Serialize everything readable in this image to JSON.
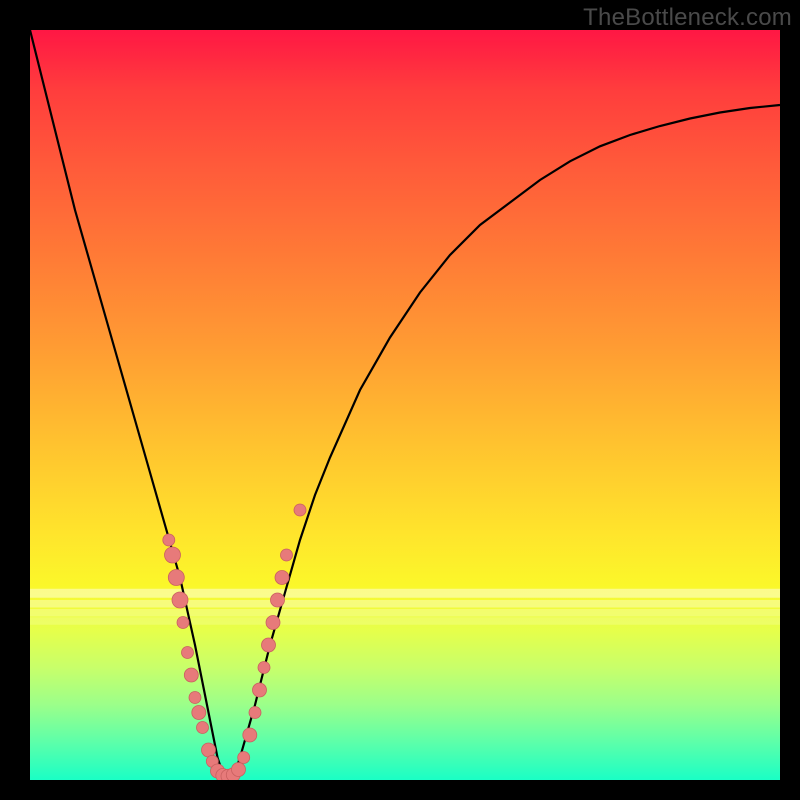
{
  "watermark": "TheBottleneck.com",
  "colors": {
    "curve_stroke": "#000000",
    "dot_fill": "#e77a7a",
    "dot_stroke": "#c96060"
  },
  "chart_data": {
    "type": "line",
    "title": "",
    "xlabel": "",
    "ylabel": "",
    "xlim": [
      0,
      100
    ],
    "ylim": [
      0,
      100
    ],
    "series": [
      {
        "name": "bottleneck-curve",
        "x": [
          0,
          2,
          4,
          6,
          8,
          10,
          12,
          14,
          16,
          18,
          20,
          22,
          23,
          24,
          25,
          26,
          27,
          28,
          30,
          32,
          34,
          36,
          38,
          40,
          44,
          48,
          52,
          56,
          60,
          64,
          68,
          72,
          76,
          80,
          84,
          88,
          92,
          96,
          100
        ],
        "y": [
          100,
          92,
          84,
          76,
          69,
          62,
          55,
          48,
          41,
          34,
          27,
          18,
          13,
          8,
          3,
          0,
          0,
          3,
          10,
          18,
          25,
          32,
          38,
          43,
          52,
          59,
          65,
          70,
          74,
          77,
          80,
          82.5,
          84.5,
          86,
          87.2,
          88.2,
          89,
          89.6,
          90
        ]
      }
    ],
    "points": [
      {
        "x": 18.5,
        "y": 32,
        "r": 6
      },
      {
        "x": 19.0,
        "y": 30,
        "r": 8
      },
      {
        "x": 19.5,
        "y": 27,
        "r": 8
      },
      {
        "x": 20.0,
        "y": 24,
        "r": 8
      },
      {
        "x": 20.4,
        "y": 21,
        "r": 6
      },
      {
        "x": 21.0,
        "y": 17,
        "r": 6
      },
      {
        "x": 21.5,
        "y": 14,
        "r": 7
      },
      {
        "x": 22.0,
        "y": 11,
        "r": 6
      },
      {
        "x": 22.5,
        "y": 9,
        "r": 7
      },
      {
        "x": 23.0,
        "y": 7,
        "r": 6
      },
      {
        "x": 23.8,
        "y": 4,
        "r": 7
      },
      {
        "x": 24.3,
        "y": 2.5,
        "r": 6
      },
      {
        "x": 25.0,
        "y": 1.2,
        "r": 7
      },
      {
        "x": 25.7,
        "y": 0.6,
        "r": 7
      },
      {
        "x": 26.4,
        "y": 0.5,
        "r": 7
      },
      {
        "x": 27.1,
        "y": 0.7,
        "r": 7
      },
      {
        "x": 27.8,
        "y": 1.4,
        "r": 7
      },
      {
        "x": 28.5,
        "y": 3.0,
        "r": 6
      },
      {
        "x": 29.3,
        "y": 6.0,
        "r": 7
      },
      {
        "x": 30.0,
        "y": 9.0,
        "r": 6
      },
      {
        "x": 30.6,
        "y": 12,
        "r": 7
      },
      {
        "x": 31.2,
        "y": 15,
        "r": 6
      },
      {
        "x": 31.8,
        "y": 18,
        "r": 7
      },
      {
        "x": 32.4,
        "y": 21,
        "r": 7
      },
      {
        "x": 33.0,
        "y": 24,
        "r": 7
      },
      {
        "x": 33.6,
        "y": 27,
        "r": 7
      },
      {
        "x": 34.2,
        "y": 30,
        "r": 6
      },
      {
        "x": 36.0,
        "y": 36,
        "r": 6
      }
    ],
    "bands": [
      {
        "y": 74.5,
        "h": 1.2,
        "color": "#ffffff",
        "alpha": 0.45
      },
      {
        "y": 76.0,
        "h": 1.0,
        "color": "#ffffff",
        "alpha": 0.35
      },
      {
        "y": 77.2,
        "h": 1.0,
        "color": "#ffffff",
        "alpha": 0.25
      },
      {
        "y": 78.3,
        "h": 1.0,
        "color": "#ffffff",
        "alpha": 0.18
      }
    ]
  }
}
